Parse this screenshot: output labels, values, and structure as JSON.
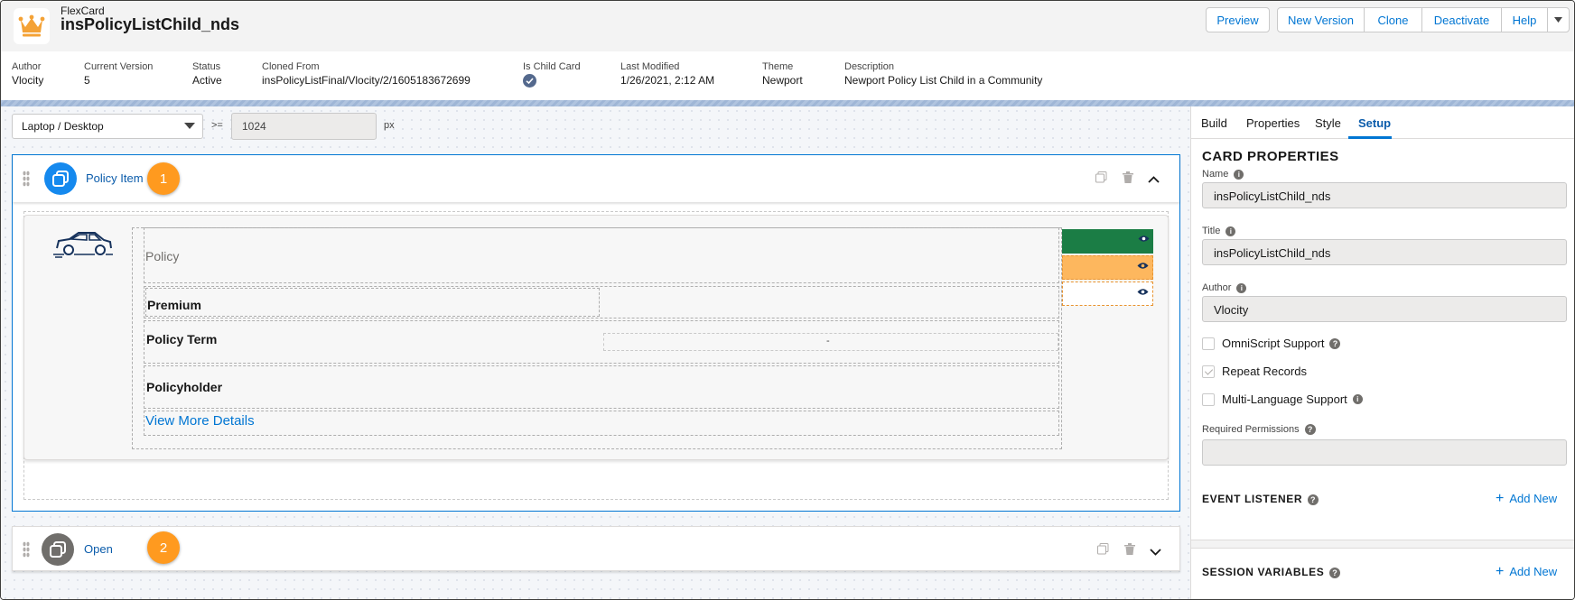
{
  "header": {
    "type_label": "FlexCard",
    "title": "insPolicyListChild_nds",
    "buttons": {
      "preview": "Preview",
      "new_version": "New Version",
      "clone": "Clone",
      "deactivate": "Deactivate",
      "help": "Help"
    }
  },
  "meta": {
    "author": {
      "label": "Author",
      "value": "Vlocity"
    },
    "current_version": {
      "label": "Current Version",
      "value": "5"
    },
    "status": {
      "label": "Status",
      "value": "Active"
    },
    "cloned_from": {
      "label": "Cloned From",
      "value": "insPolicyListFinal/Vlocity/2/1605183672699"
    },
    "is_child_card": {
      "label": "Is Child Card",
      "value": true
    },
    "last_modified": {
      "label": "Last Modified",
      "value": "1/26/2021, 2:12 AM"
    },
    "theme": {
      "label": "Theme",
      "value": "Newport"
    },
    "description": {
      "label": "Description",
      "value": "Newport Policy List Child in a Community"
    }
  },
  "canvas": {
    "device": "Laptop / Desktop",
    "operator": ">=",
    "width_value": "1024",
    "unit": "px",
    "cards": [
      {
        "name": "Policy Item",
        "badge": "1",
        "expanded": true,
        "content": {
          "policy_text": "Policy",
          "premium_label": "Premium",
          "policy_term_label": "Policy Term",
          "policy_term_value": "-",
          "policyholder_label": "Policyholder",
          "link": "View More Details"
        }
      },
      {
        "name": "Open",
        "badge": "2",
        "expanded": false
      }
    ],
    "action_colors": [
      "#1b7d45",
      "#fdb75e",
      "#ffffff"
    ]
  },
  "panel": {
    "tabs": [
      "Build",
      "Properties",
      "Style",
      "Setup"
    ],
    "active_tab": "Setup",
    "card_properties": {
      "title": "CARD PROPERTIES",
      "name_label": "Name",
      "name_value": "insPolicyListChild_nds",
      "title_label": "Title",
      "title_value": "insPolicyListChild_nds",
      "author_label": "Author",
      "author_value": "Vlocity",
      "checkboxes": [
        {
          "label": "OmniScript Support",
          "checked": false
        },
        {
          "label": "Repeat Records",
          "checked": true
        },
        {
          "label": "Multi-Language Support",
          "checked": false
        }
      ],
      "required_permissions_label": "Required Permissions",
      "required_permissions_value": ""
    },
    "event_listener": {
      "title": "EVENT LISTENER",
      "add_label": "Add New"
    },
    "session_variables": {
      "title": "SESSION VARIABLES",
      "add_label": "Add New"
    }
  },
  "colors": {
    "accent": "#0176d3",
    "badge": "#ff9a1f",
    "card_icon_1": "#1589ee",
    "card_icon_2": "#706e6b",
    "logo": "#f4a236"
  }
}
